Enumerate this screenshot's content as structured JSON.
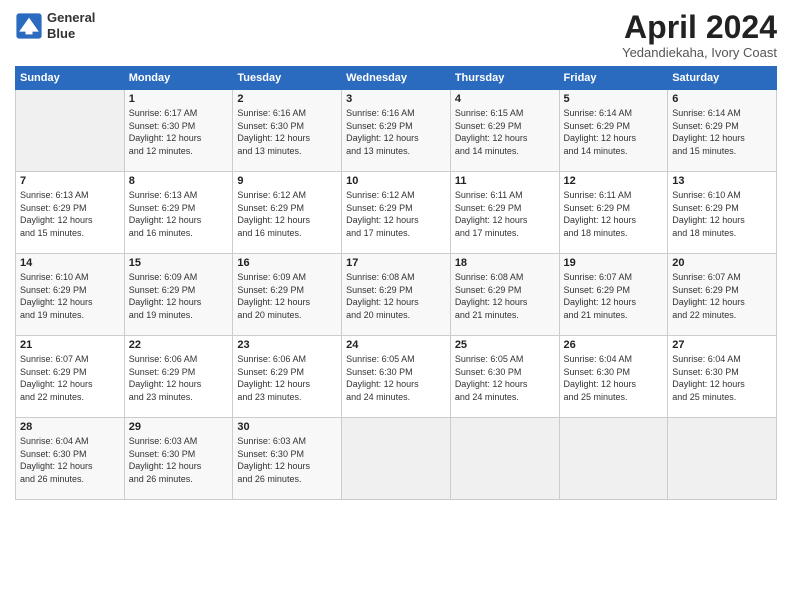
{
  "header": {
    "logo_line1": "General",
    "logo_line2": "Blue",
    "month": "April 2024",
    "location": "Yedandiekaha, Ivory Coast"
  },
  "days_of_week": [
    "Sunday",
    "Monday",
    "Tuesday",
    "Wednesday",
    "Thursday",
    "Friday",
    "Saturday"
  ],
  "weeks": [
    [
      {
        "num": "",
        "info": ""
      },
      {
        "num": "1",
        "info": "Sunrise: 6:17 AM\nSunset: 6:30 PM\nDaylight: 12 hours\nand 12 minutes."
      },
      {
        "num": "2",
        "info": "Sunrise: 6:16 AM\nSunset: 6:30 PM\nDaylight: 12 hours\nand 13 minutes."
      },
      {
        "num": "3",
        "info": "Sunrise: 6:16 AM\nSunset: 6:29 PM\nDaylight: 12 hours\nand 13 minutes."
      },
      {
        "num": "4",
        "info": "Sunrise: 6:15 AM\nSunset: 6:29 PM\nDaylight: 12 hours\nand 14 minutes."
      },
      {
        "num": "5",
        "info": "Sunrise: 6:14 AM\nSunset: 6:29 PM\nDaylight: 12 hours\nand 14 minutes."
      },
      {
        "num": "6",
        "info": "Sunrise: 6:14 AM\nSunset: 6:29 PM\nDaylight: 12 hours\nand 15 minutes."
      }
    ],
    [
      {
        "num": "7",
        "info": "Sunrise: 6:13 AM\nSunset: 6:29 PM\nDaylight: 12 hours\nand 15 minutes."
      },
      {
        "num": "8",
        "info": "Sunrise: 6:13 AM\nSunset: 6:29 PM\nDaylight: 12 hours\nand 16 minutes."
      },
      {
        "num": "9",
        "info": "Sunrise: 6:12 AM\nSunset: 6:29 PM\nDaylight: 12 hours\nand 16 minutes."
      },
      {
        "num": "10",
        "info": "Sunrise: 6:12 AM\nSunset: 6:29 PM\nDaylight: 12 hours\nand 17 minutes."
      },
      {
        "num": "11",
        "info": "Sunrise: 6:11 AM\nSunset: 6:29 PM\nDaylight: 12 hours\nand 17 minutes."
      },
      {
        "num": "12",
        "info": "Sunrise: 6:11 AM\nSunset: 6:29 PM\nDaylight: 12 hours\nand 18 minutes."
      },
      {
        "num": "13",
        "info": "Sunrise: 6:10 AM\nSunset: 6:29 PM\nDaylight: 12 hours\nand 18 minutes."
      }
    ],
    [
      {
        "num": "14",
        "info": "Sunrise: 6:10 AM\nSunset: 6:29 PM\nDaylight: 12 hours\nand 19 minutes."
      },
      {
        "num": "15",
        "info": "Sunrise: 6:09 AM\nSunset: 6:29 PM\nDaylight: 12 hours\nand 19 minutes."
      },
      {
        "num": "16",
        "info": "Sunrise: 6:09 AM\nSunset: 6:29 PM\nDaylight: 12 hours\nand 20 minutes."
      },
      {
        "num": "17",
        "info": "Sunrise: 6:08 AM\nSunset: 6:29 PM\nDaylight: 12 hours\nand 20 minutes."
      },
      {
        "num": "18",
        "info": "Sunrise: 6:08 AM\nSunset: 6:29 PM\nDaylight: 12 hours\nand 21 minutes."
      },
      {
        "num": "19",
        "info": "Sunrise: 6:07 AM\nSunset: 6:29 PM\nDaylight: 12 hours\nand 21 minutes."
      },
      {
        "num": "20",
        "info": "Sunrise: 6:07 AM\nSunset: 6:29 PM\nDaylight: 12 hours\nand 22 minutes."
      }
    ],
    [
      {
        "num": "21",
        "info": "Sunrise: 6:07 AM\nSunset: 6:29 PM\nDaylight: 12 hours\nand 22 minutes."
      },
      {
        "num": "22",
        "info": "Sunrise: 6:06 AM\nSunset: 6:29 PM\nDaylight: 12 hours\nand 23 minutes."
      },
      {
        "num": "23",
        "info": "Sunrise: 6:06 AM\nSunset: 6:29 PM\nDaylight: 12 hours\nand 23 minutes."
      },
      {
        "num": "24",
        "info": "Sunrise: 6:05 AM\nSunset: 6:30 PM\nDaylight: 12 hours\nand 24 minutes."
      },
      {
        "num": "25",
        "info": "Sunrise: 6:05 AM\nSunset: 6:30 PM\nDaylight: 12 hours\nand 24 minutes."
      },
      {
        "num": "26",
        "info": "Sunrise: 6:04 AM\nSunset: 6:30 PM\nDaylight: 12 hours\nand 25 minutes."
      },
      {
        "num": "27",
        "info": "Sunrise: 6:04 AM\nSunset: 6:30 PM\nDaylight: 12 hours\nand 25 minutes."
      }
    ],
    [
      {
        "num": "28",
        "info": "Sunrise: 6:04 AM\nSunset: 6:30 PM\nDaylight: 12 hours\nand 26 minutes."
      },
      {
        "num": "29",
        "info": "Sunrise: 6:03 AM\nSunset: 6:30 PM\nDaylight: 12 hours\nand 26 minutes."
      },
      {
        "num": "30",
        "info": "Sunrise: 6:03 AM\nSunset: 6:30 PM\nDaylight: 12 hours\nand 26 minutes."
      },
      {
        "num": "",
        "info": ""
      },
      {
        "num": "",
        "info": ""
      },
      {
        "num": "",
        "info": ""
      },
      {
        "num": "",
        "info": ""
      }
    ]
  ]
}
